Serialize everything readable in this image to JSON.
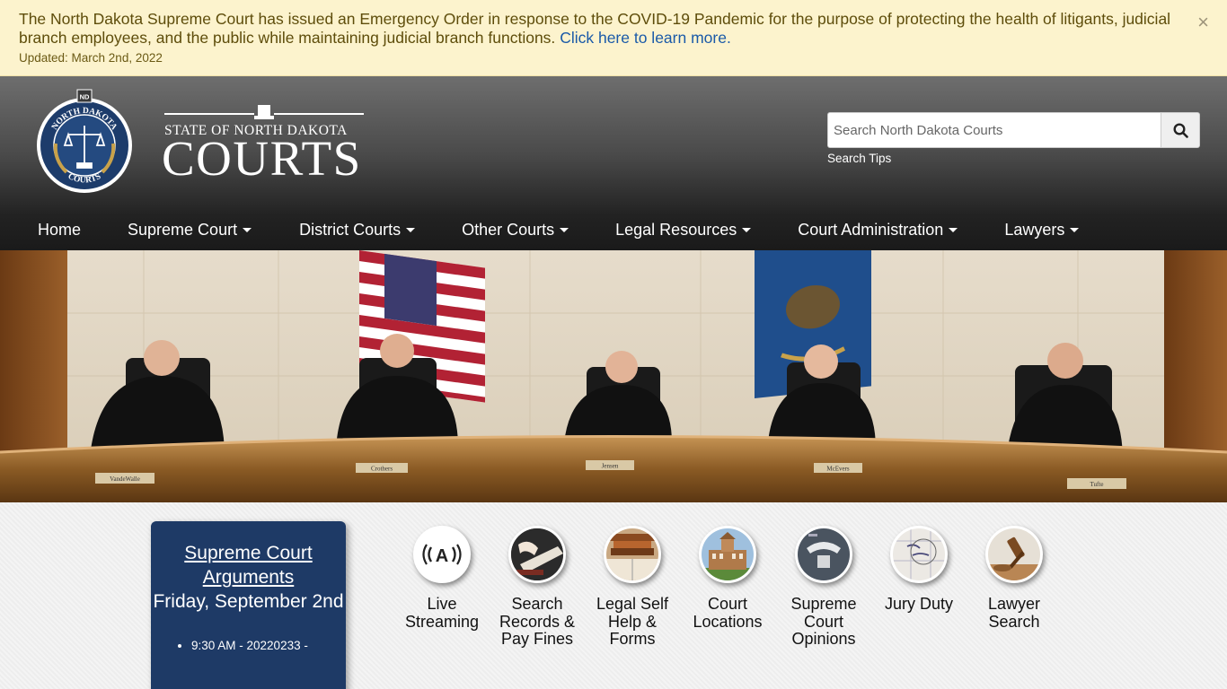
{
  "alert": {
    "message": "The North Dakota Supreme Court has issued an Emergency Order in response to the COVID-19 Pandemic for the purpose of protecting the health of litigants, judicial branch employees, and the public while maintaining judicial branch functions.",
    "link_text": "Click here to learn more.",
    "updated": "Updated: March 2nd, 2022",
    "close_glyph": "×"
  },
  "header": {
    "seal_top": "NORTH DAKOTA",
    "seal_bottom": "COURTS",
    "seal_badge": "ND",
    "wordmark_small": "STATE OF NORTH DAKOTA",
    "wordmark_big": "COURTS",
    "search_placeholder": "Search North Dakota Courts",
    "search_icon": "search-icon",
    "search_tips": "Search Tips"
  },
  "nav": {
    "items": [
      {
        "label": "Home",
        "dropdown": false
      },
      {
        "label": "Supreme Court",
        "dropdown": true
      },
      {
        "label": "District Courts",
        "dropdown": true
      },
      {
        "label": "Other Courts",
        "dropdown": true
      },
      {
        "label": "Legal Resources",
        "dropdown": true
      },
      {
        "label": "Court Administration",
        "dropdown": true
      },
      {
        "label": "Lawyers",
        "dropdown": true
      }
    ]
  },
  "hero": {
    "nameplates": [
      "VandeWalle",
      "Crothers",
      "Jensen",
      "McEvers",
      "Tufte"
    ]
  },
  "arguments": {
    "title": "Supreme Court Arguments",
    "date": "Friday, September 2nd",
    "items": [
      "9:30 AM - 20220233 -"
    ]
  },
  "quick_links": [
    {
      "label": "Live Streaming",
      "icon": "live-stream-icon"
    },
    {
      "label": "Search Records & Pay Fines",
      "icon": "records-icon"
    },
    {
      "label": "Legal Self Help & Forms",
      "icon": "books-icon"
    },
    {
      "label": "Court Locations",
      "icon": "courthouse-icon"
    },
    {
      "label": "Supreme Court Opinions",
      "icon": "opinions-icon"
    },
    {
      "label": "Jury Duty",
      "icon": "calendar-icon"
    },
    {
      "label": "Lawyer Search",
      "icon": "gavel-icon"
    }
  ],
  "colors": {
    "alert_bg": "#fcf3cd",
    "link": "#1a5aa8",
    "card_bg": "#1e3a66"
  }
}
